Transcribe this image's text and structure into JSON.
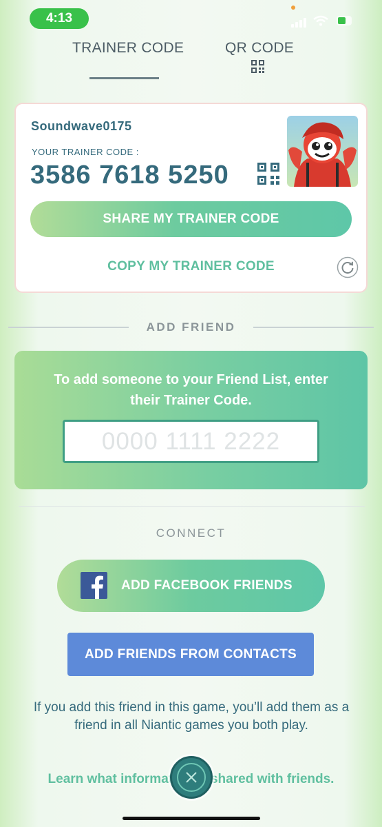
{
  "status_bar": {
    "time": "4:13"
  },
  "tabs": [
    {
      "label": "TRAINER CODE",
      "active": true
    },
    {
      "label": "QR CODE",
      "active": false
    }
  ],
  "trainer": {
    "username": "Soundwave0175",
    "code_label": "YOUR TRAINER CODE :",
    "code": "3586 7618 5250",
    "share_label": "SHARE MY TRAINER CODE",
    "copy_label": "COPY MY TRAINER CODE"
  },
  "add_friend": {
    "title": "ADD FRIEND",
    "instructions": "To add someone to your Friend List, enter their Trainer Code.",
    "placeholder": "0000 1111 2222"
  },
  "connect": {
    "title": "CONNECT",
    "facebook_label": "ADD FACEBOOK FRIENDS",
    "contacts_label": "ADD FRIENDS FROM CONTACTS",
    "info": "If you add this friend in this game, you’ll add them as a friend in all Niantic games you both play.",
    "learn_more": "Learn what information is shared with friends."
  },
  "icons": {
    "qr": "qr-code-icon",
    "refresh": "refresh-icon",
    "facebook": "facebook-icon",
    "close": "close-icon"
  },
  "colors": {
    "accent_green": "#5fbf9f",
    "text_teal": "#356a7c",
    "contacts_blue": "#5d8ad9",
    "time_pill": "#39c14a"
  }
}
